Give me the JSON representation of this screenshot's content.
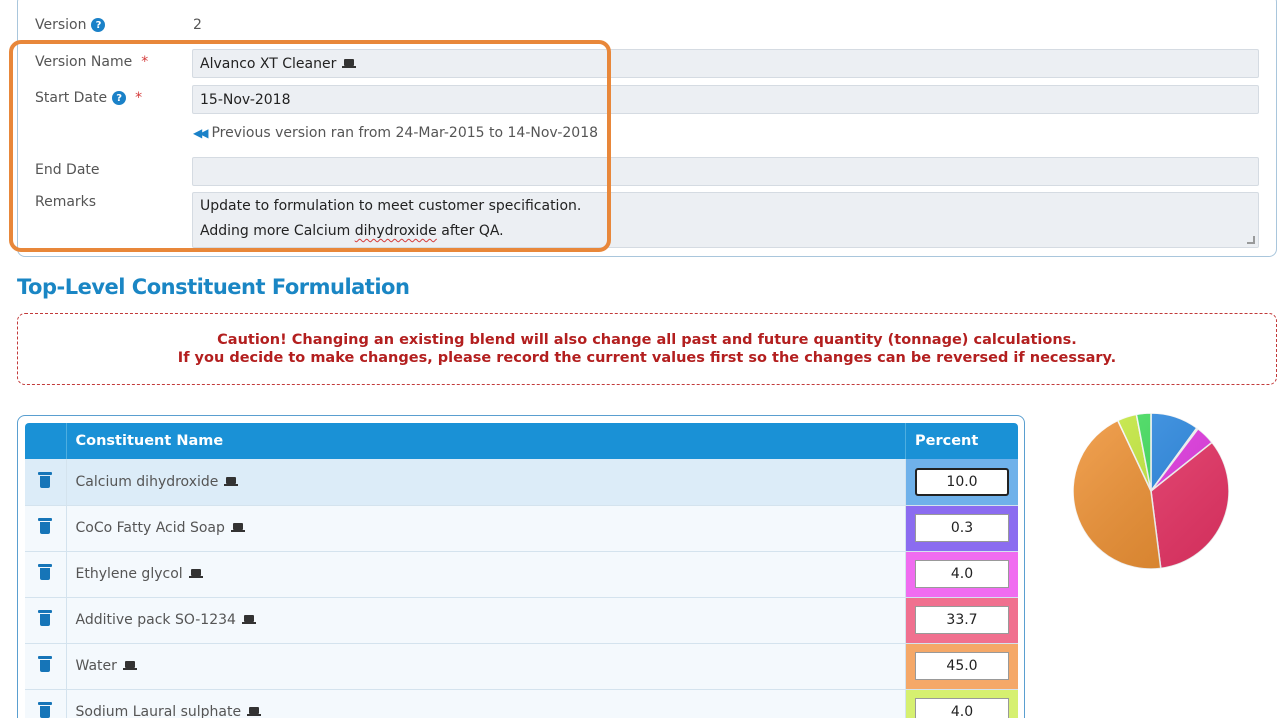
{
  "form": {
    "version_label": "Version",
    "version_value": "2",
    "version_name_label": "Version Name",
    "version_name_value": "Alvanco XT Cleaner",
    "start_date_label": "Start Date",
    "start_date_value": "15-Nov-2018",
    "previous_version_text": "Previous version ran from 24-Mar-2015 to 14-Nov-2018",
    "end_date_label": "End Date",
    "end_date_value": "",
    "remarks_label": "Remarks",
    "remarks_line1": "Update to formulation to meet customer specification.",
    "remarks_line2_a": "Adding more Calcium ",
    "remarks_line2_b": "dihydroxide",
    "remarks_line2_c": " after QA.",
    "required_mark": "*",
    "help_glyph": "?"
  },
  "section_title": "Top-Level Constituent Formulation",
  "caution": {
    "line1": "Caution! Changing an existing blend will also change all past and future quantity (tonnage) calculations.",
    "line2": "If you decide to make changes, please record the current values first so the changes can be reversed if necessary."
  },
  "table": {
    "col_name": "Constituent Name",
    "col_percent": "Percent",
    "rows": [
      {
        "name": "Calcium dihydroxide",
        "percent": "10.0",
        "color": "#6fb1ea"
      },
      {
        "name": "CoCo Fatty Acid Soap",
        "percent": "0.3",
        "color": "#8b6cf0"
      },
      {
        "name": "Ethylene glycol",
        "percent": "4.0",
        "color": "#f06cf0"
      },
      {
        "name": "Additive pack SO-1234",
        "percent": "33.7",
        "color": "#f0708f"
      },
      {
        "name": "Water",
        "percent": "45.0",
        "color": "#f5a868"
      },
      {
        "name": "Sodium Laural sulphate",
        "percent": "4.0",
        "color": "#d6f070"
      }
    ]
  },
  "chart_data": {
    "type": "pie",
    "categories": [
      "Calcium dihydroxide",
      "CoCo Fatty Acid Soap",
      "Ethylene glycol",
      "Additive pack SO-1234",
      "Water",
      "Sodium Laural sulphate",
      "Other"
    ],
    "values": [
      10.0,
      0.3,
      4.0,
      33.7,
      45.0,
      4.0,
      3.0
    ],
    "colors": [
      "#2b8be6",
      "#7b4dea",
      "#e639e6",
      "#ee3568",
      "#f0902f",
      "#c6ec3a",
      "#3ee05a"
    ]
  }
}
